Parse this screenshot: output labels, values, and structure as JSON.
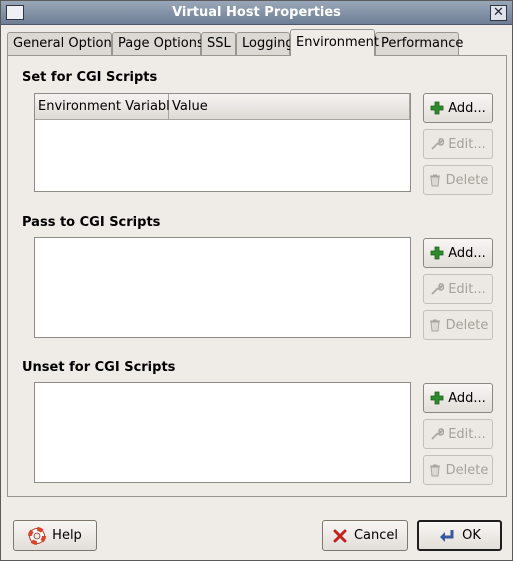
{
  "window": {
    "title": "Virtual Host Properties",
    "close_glyph": "✕"
  },
  "tabs": [
    {
      "label": "General Options",
      "active": false
    },
    {
      "label": "Page Options",
      "active": false
    },
    {
      "label": "SSL",
      "active": false
    },
    {
      "label": "Logging",
      "active": false
    },
    {
      "label": "Environment",
      "active": true
    },
    {
      "label": "Performance",
      "active": false
    }
  ],
  "sections": [
    {
      "title": "Set for CGI Scripts",
      "columns": [
        "Environment Variable",
        "Value"
      ],
      "buttons": {
        "add": "Add...",
        "edit": "Edit...",
        "delete": "Delete"
      }
    },
    {
      "title": "Pass to CGI Scripts",
      "buttons": {
        "add": "Add...",
        "edit": "Edit...",
        "delete": "Delete"
      }
    },
    {
      "title": "Unset for CGI Scripts",
      "buttons": {
        "add": "Add...",
        "edit": "Edit...",
        "delete": "Delete"
      }
    }
  ],
  "footer": {
    "help_label": "Help",
    "cancel_label": "Cancel",
    "ok_label": "OK"
  },
  "colors": {
    "add_icon": "#2e8b2e",
    "cancel_icon": "#c0221f",
    "help_icon": "#d9452b",
    "ok_icon": "#37579e",
    "disabled_text": "#a5a19b"
  }
}
